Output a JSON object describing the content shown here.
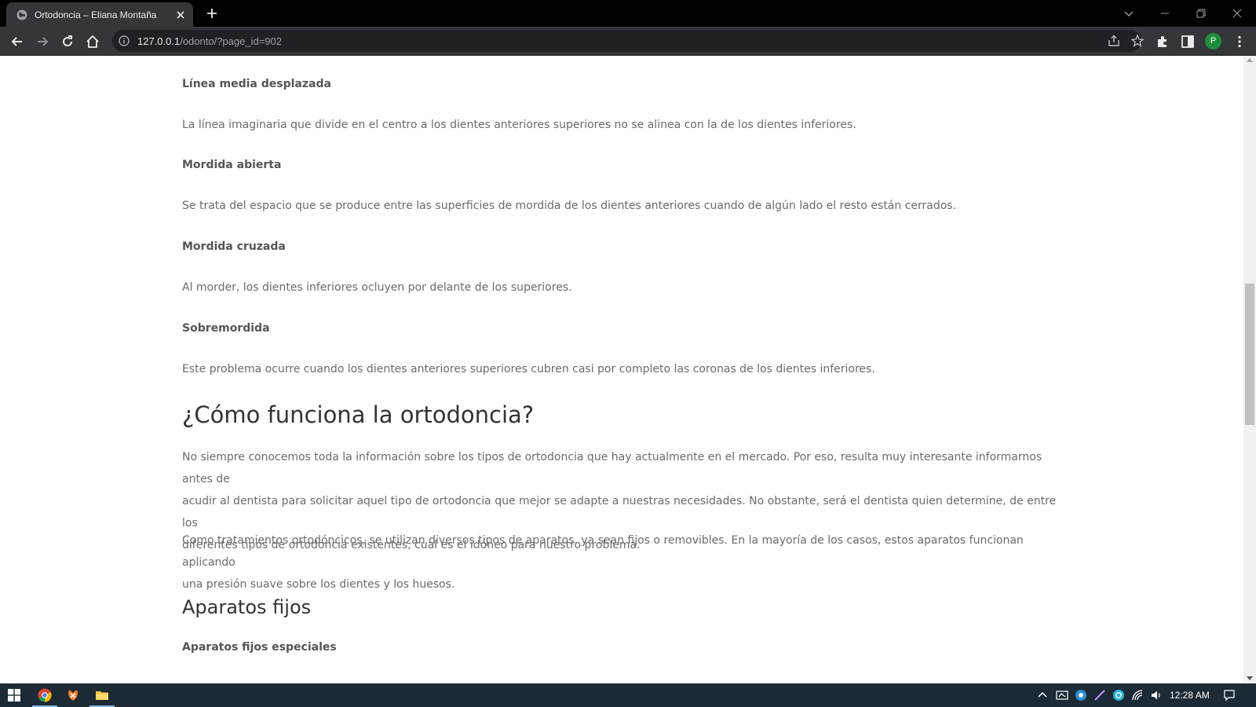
{
  "browser": {
    "tab_title": "Ortodoncia – Eliana Montaña",
    "url_host": "127.0.0.1",
    "url_path": "/odonto/?page_id=902",
    "profile_initial": "P"
  },
  "article": {
    "s1_title": "Línea media desplazada",
    "s1_text": "La línea imaginaria que divide en el centro a los dientes anteriores superiores no se alinea con la de los dientes inferiores.",
    "s2_title": "Mordida abierta",
    "s2_text": "Se trata del espacio que se produce entre las superficies de mordida de los dientes anteriores cuando de algún lado el resto están cerrados.",
    "s3_title": "Mordida cruzada",
    "s3_text": "Al morder, los dientes inferiores ocluyen por delante de los superiores.",
    "s4_title": "Sobremordida",
    "s4_text": "Este problema ocurre cuando los dientes anteriores superiores cubren casi por completo las coronas de los dientes inferiores.",
    "heading2": "¿Cómo funciona la ortodoncia?",
    "p1_line1": "No siempre conocemos toda la información sobre los tipos de ortodoncia que hay actualmente en el mercado. Por eso, resulta muy interesante informarnos antes de",
    "p1_line2": "acudir al dentista para solicitar aquel tipo de ortodoncia que mejor se adapte a nuestras necesidades. No obstante, será el dentista quien determine, de entre los",
    "p1_line3": "diferentes tipos de ortodoncia existentes, cual es el idóneo para nuestro problema.",
    "p2_line1": "Como tratamientos ortodóncicos, se utilizan diversos tipos de aparatos, ya sean fijos o removibles. En la mayoría de los casos, estos aparatos funcionan aplicando",
    "p2_line2": "una presión suave sobre los dientes y los huesos.",
    "heading3": "Aparatos fijos",
    "s5_title": "Aparatos fijos especiales"
  },
  "taskbar": {
    "clock": "12:28 AM"
  },
  "colors": {
    "chrome_dark": "#35363a",
    "taskbar": "#1b2a35",
    "text_body": "#6b6b6b",
    "heading": "#333333"
  }
}
